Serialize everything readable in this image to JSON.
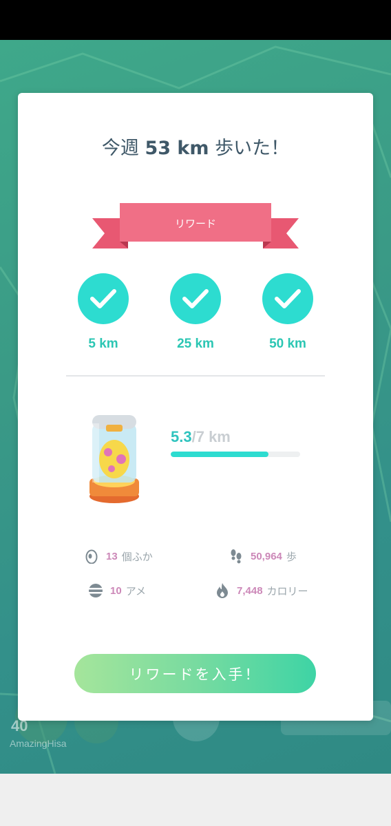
{
  "title": {
    "prefix": "今週",
    "distance": "53 km",
    "suffix": "歩いた！"
  },
  "ribbon": {
    "label": "リワード"
  },
  "milestones": [
    {
      "label": "5 km",
      "achieved": true
    },
    {
      "label": "25 km",
      "achieved": true
    },
    {
      "label": "50 km",
      "achieved": true
    }
  ],
  "egg_progress": {
    "current": "5.3",
    "separator": "/",
    "total": "7 km",
    "fraction": 0.757
  },
  "stats": {
    "hatched": {
      "value": "13",
      "unit": "個ふか",
      "icon": "egg-icon"
    },
    "steps": {
      "value": "50,964",
      "unit": "歩",
      "icon": "footprints-icon"
    },
    "candy": {
      "value": "10",
      "unit": "アメ",
      "icon": "candy-icon"
    },
    "calories": {
      "value": "7,448",
      "unit": "カロリー",
      "icon": "flame-icon"
    }
  },
  "cta": {
    "label": "リワードを入手！"
  },
  "background": {
    "player_level": "40",
    "player_name": "AmazingHisa"
  },
  "colors": {
    "accent_teal": "#2ddcd0",
    "ribbon_pink": "#f06f86",
    "stat_value": "#cc88b8",
    "title_text": "#3f5868"
  }
}
